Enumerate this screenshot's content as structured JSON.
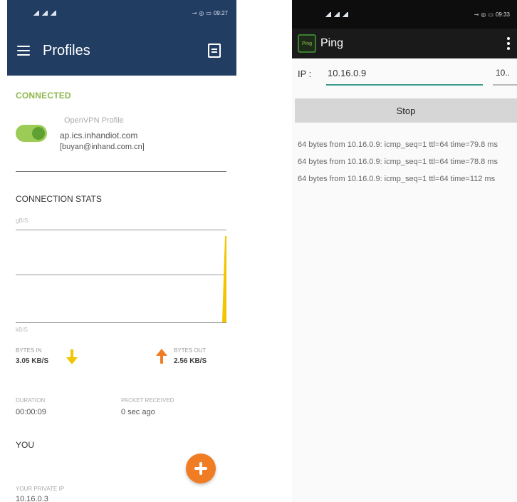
{
  "left_phone": {
    "status_bar": {
      "time": "09:27"
    },
    "app_bar": {
      "title": "Profiles"
    },
    "connection": {
      "status": "CONNECTED",
      "profile_type": "OpenVPN Profile",
      "host": "ap.ics.inhandiot.com",
      "user": "[buyan@inhand.com.cn]",
      "toggle_on": true
    },
    "stats": {
      "title": "CONNECTION STATS",
      "chart_unit_top": "gB/S",
      "chart_unit_bottom": "kB/S",
      "bytes_in_label": "BYTES IN",
      "bytes_in_value": "3.05 KB/S",
      "bytes_out_label": "BYTES OUT",
      "bytes_out_value": "2.56 KB/S",
      "duration_label": "DURATION",
      "duration_value": "00:00:09",
      "packet_label": "PACKET RECEIVED",
      "packet_value": "0 sec ago"
    },
    "you": {
      "title": "YOU",
      "private_ip_label": "YOUR PRIVATE IP",
      "private_ip_value": "10.16.0.3"
    },
    "colors": {
      "header": "#213d62",
      "connected": "#8fb84c",
      "fab": "#f07d24",
      "arrow_in": "#f2c500",
      "arrow_out": "#f07d24"
    }
  },
  "right_phone": {
    "status_bar": {
      "time": "09:33"
    },
    "app_bar": {
      "title": "Ping",
      "icon_text": "Ping"
    },
    "form": {
      "ip_label": "IP :",
      "ip_value": "10.16.0.9",
      "count_value": "10..",
      "stop_label": "Stop"
    },
    "output": [
      "64 bytes from 10.16.0.9: icmp_seq=1 ttl=64 time=79.8 ms",
      "64 bytes from 10.16.0.9: icmp_seq=1 ttl=64 time=78.8 ms",
      "64 bytes from 10.16.0.9: icmp_seq=1 ttl=64 time=112 ms"
    ]
  }
}
